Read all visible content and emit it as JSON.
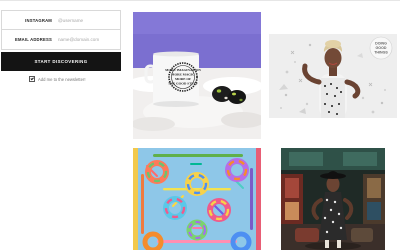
{
  "form": {
    "instagram": {
      "label": "INSTAGRAM",
      "placeholder": "@username"
    },
    "email": {
      "label": "EMAIL ADDRESS",
      "placeholder": "name@domain.com"
    },
    "submit_label": "START DISCOVERING",
    "newsletter_label": "Add me to the newsletter!",
    "newsletter_checked": true
  },
  "gallery": {
    "mug": {
      "mug_print": [
        "MORE IMAGINATION",
        "MORE MAGIC",
        "MORE OF",
        "THE GOOD STUFF"
      ]
    },
    "woman": {
      "badge": [
        "DOING",
        "GOOD",
        "THINGS"
      ]
    }
  },
  "colors": {
    "button_bg": "#141414",
    "mug_backdrop": "#7b6fd0",
    "bagel_backdrop": "#8ec7e8"
  }
}
